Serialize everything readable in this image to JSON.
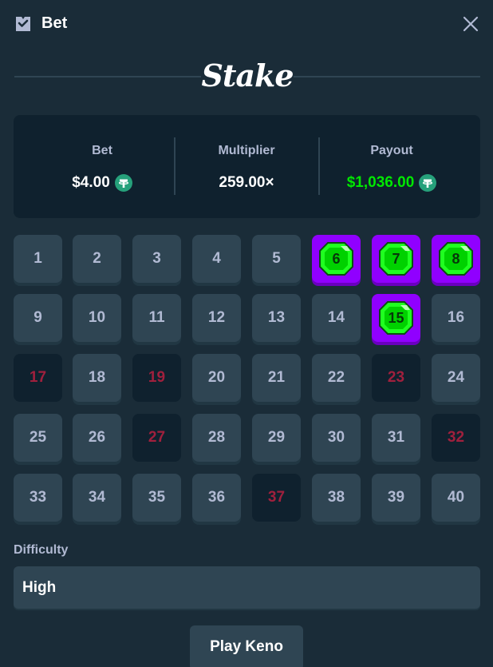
{
  "header": {
    "title": "Bet",
    "icon": "bet-ticket-icon",
    "close_icon": "close-icon"
  },
  "brand": {
    "logo_text": "Stake"
  },
  "stats": {
    "bet": {
      "label": "Bet",
      "value": "$4.00",
      "currency_icon": "tether-icon"
    },
    "multiplier": {
      "label": "Multiplier",
      "value": "259.00×"
    },
    "payout": {
      "label": "Payout",
      "value": "$1,036.00",
      "currency_icon": "tether-icon",
      "color": "#00e701"
    }
  },
  "tiles": [
    {
      "n": "1",
      "state": "idle"
    },
    {
      "n": "2",
      "state": "idle"
    },
    {
      "n": "3",
      "state": "idle"
    },
    {
      "n": "4",
      "state": "idle"
    },
    {
      "n": "5",
      "state": "idle"
    },
    {
      "n": "6",
      "state": "hit"
    },
    {
      "n": "7",
      "state": "hit"
    },
    {
      "n": "8",
      "state": "hit"
    },
    {
      "n": "9",
      "state": "idle"
    },
    {
      "n": "10",
      "state": "idle"
    },
    {
      "n": "11",
      "state": "idle"
    },
    {
      "n": "12",
      "state": "idle"
    },
    {
      "n": "13",
      "state": "idle"
    },
    {
      "n": "14",
      "state": "idle"
    },
    {
      "n": "15",
      "state": "hit"
    },
    {
      "n": "16",
      "state": "idle"
    },
    {
      "n": "17",
      "state": "miss"
    },
    {
      "n": "18",
      "state": "idle"
    },
    {
      "n": "19",
      "state": "miss"
    },
    {
      "n": "20",
      "state": "idle"
    },
    {
      "n": "21",
      "state": "idle"
    },
    {
      "n": "22",
      "state": "idle"
    },
    {
      "n": "23",
      "state": "miss"
    },
    {
      "n": "24",
      "state": "idle"
    },
    {
      "n": "25",
      "state": "idle"
    },
    {
      "n": "26",
      "state": "idle"
    },
    {
      "n": "27",
      "state": "miss"
    },
    {
      "n": "28",
      "state": "idle"
    },
    {
      "n": "29",
      "state": "idle"
    },
    {
      "n": "30",
      "state": "idle"
    },
    {
      "n": "31",
      "state": "idle"
    },
    {
      "n": "32",
      "state": "miss"
    },
    {
      "n": "33",
      "state": "idle"
    },
    {
      "n": "34",
      "state": "idle"
    },
    {
      "n": "35",
      "state": "idle"
    },
    {
      "n": "36",
      "state": "idle"
    },
    {
      "n": "37",
      "state": "miss"
    },
    {
      "n": "38",
      "state": "idle"
    },
    {
      "n": "39",
      "state": "idle"
    },
    {
      "n": "40",
      "state": "idle"
    }
  ],
  "difficulty": {
    "label": "Difficulty",
    "value": "High"
  },
  "play_button": {
    "label": "Play Keno"
  },
  "colors": {
    "background": "#1a2c38",
    "panel": "#0f212e",
    "tile": "#2f4553",
    "hit_border": "#9000ff",
    "gem": "#00e701",
    "miss_text": "#a0203d"
  }
}
